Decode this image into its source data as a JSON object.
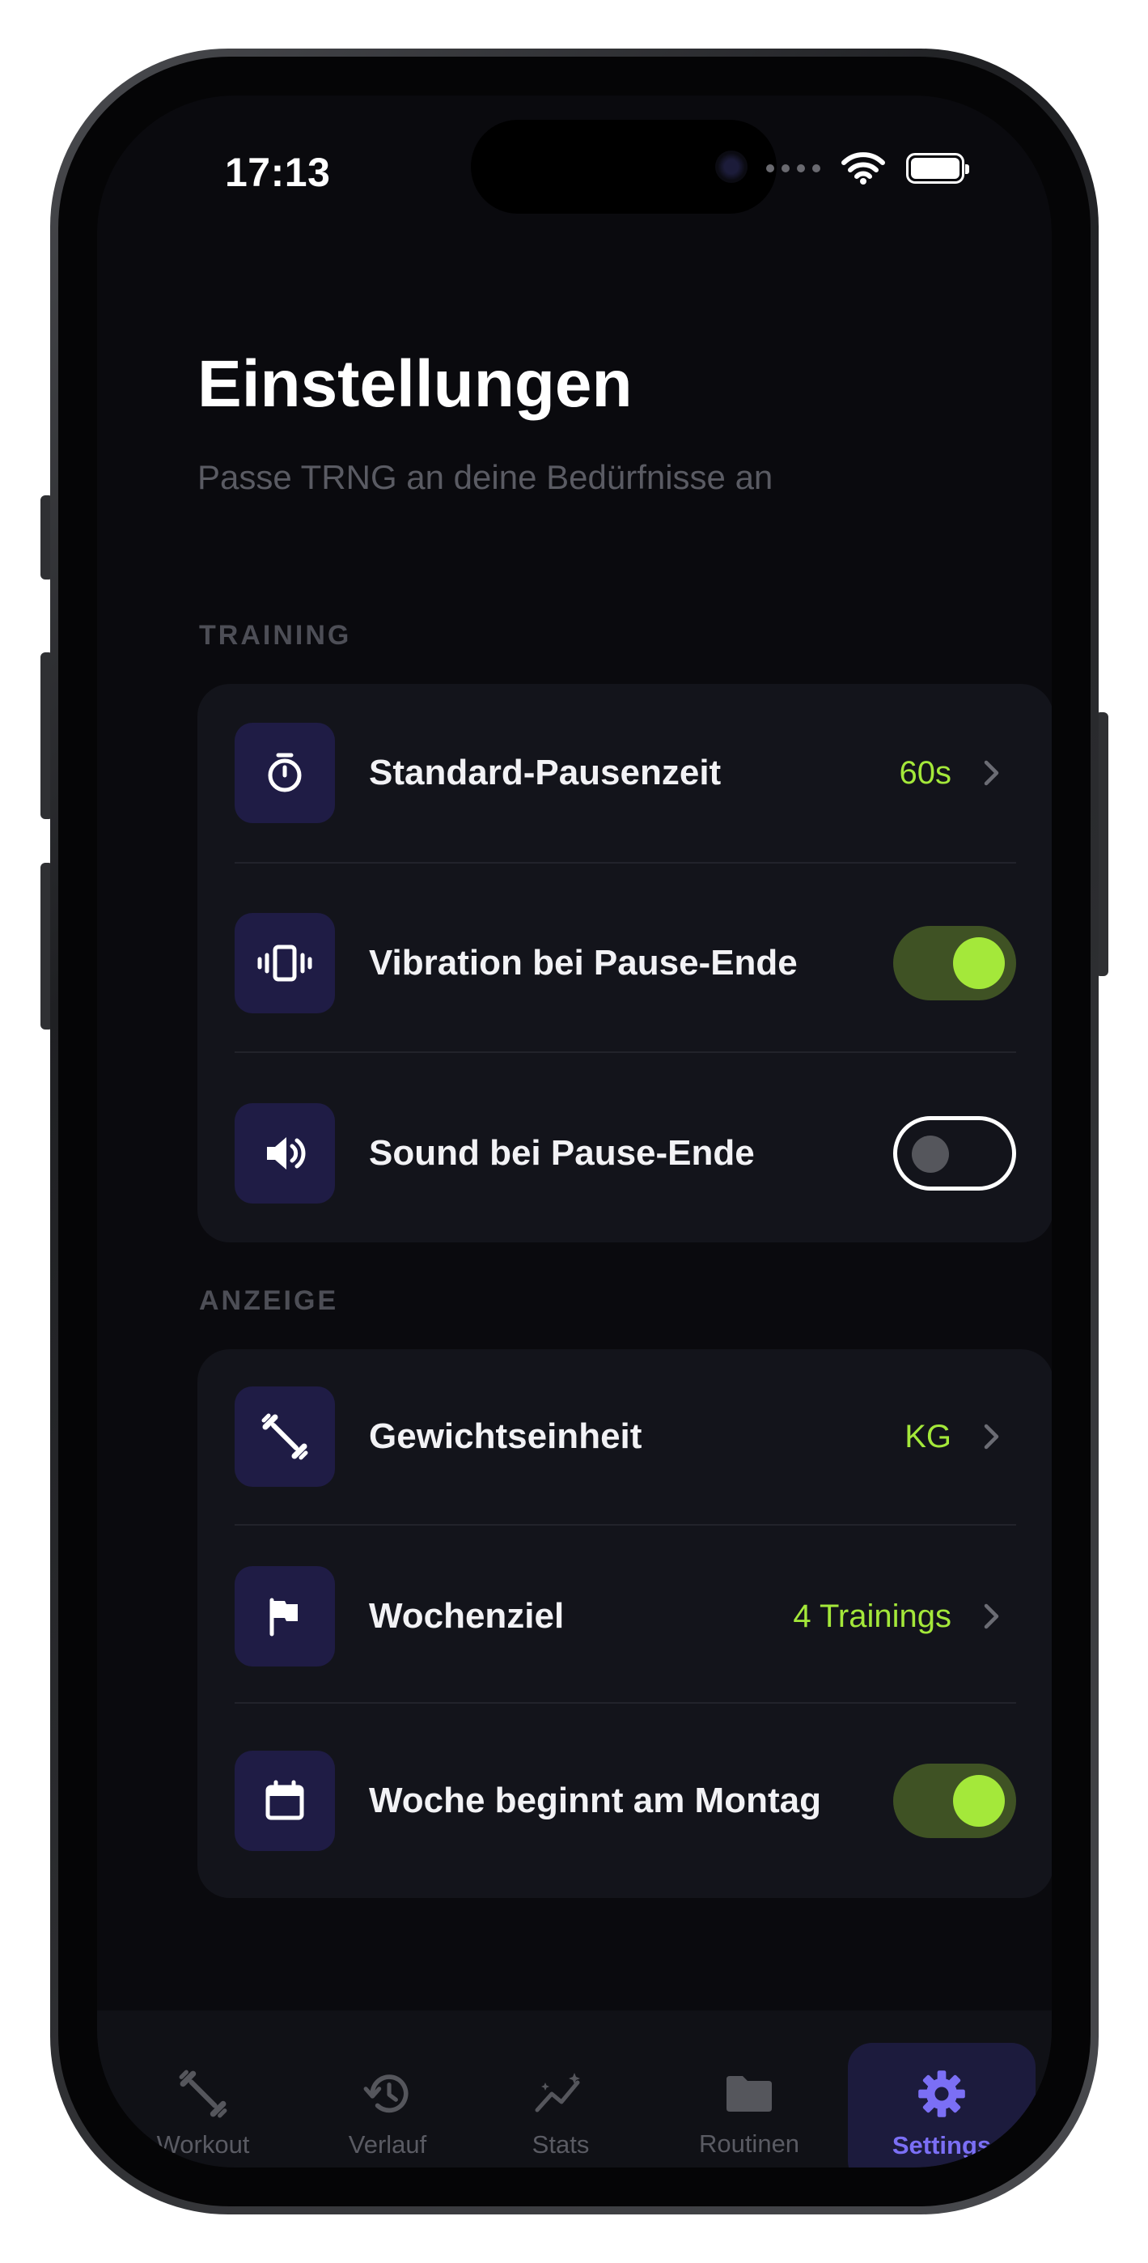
{
  "status_bar": {
    "time": "17:13"
  },
  "header": {
    "title": "Einstellungen",
    "subtitle": "Passe TRNG an deine Bedürfnisse an"
  },
  "sections": {
    "training": {
      "label": "TRAINING",
      "rows": [
        {
          "label": "Standard-Pausenzeit",
          "value": "60s",
          "icon": "stopwatch-icon"
        },
        {
          "label": "Vibration bei Pause-Ende",
          "toggle": true,
          "icon": "vibration-icon"
        },
        {
          "label": "Sound bei Pause-Ende",
          "toggle": false,
          "icon": "speaker-icon"
        }
      ]
    },
    "anzeige": {
      "label": "ANZEIGE",
      "rows": [
        {
          "label": "Gewichtseinheit",
          "value": "KG",
          "icon": "dumbbell-icon"
        },
        {
          "label": "Wochenziel",
          "value": "4 Trainings",
          "icon": "flag-icon"
        },
        {
          "label": "Woche beginnt am Montag",
          "toggle": true,
          "icon": "calendar-icon"
        }
      ]
    }
  },
  "tabbar": {
    "tabs": [
      {
        "label": "Workout",
        "icon": "dumbbell-icon",
        "active": false
      },
      {
        "label": "Verlauf",
        "icon": "history-icon",
        "active": false
      },
      {
        "label": "Stats",
        "icon": "stats-icon",
        "active": false
      },
      {
        "label": "Routinen",
        "icon": "folder-icon",
        "active": false
      },
      {
        "label": "Settings",
        "icon": "gear-icon",
        "active": true
      }
    ]
  },
  "colors": {
    "accent_green": "#a4e83a",
    "accent_purple": "#7b6ff5",
    "background": "#0a0a0e",
    "card": "#13141b",
    "icon_tile": "#1f1c45"
  }
}
